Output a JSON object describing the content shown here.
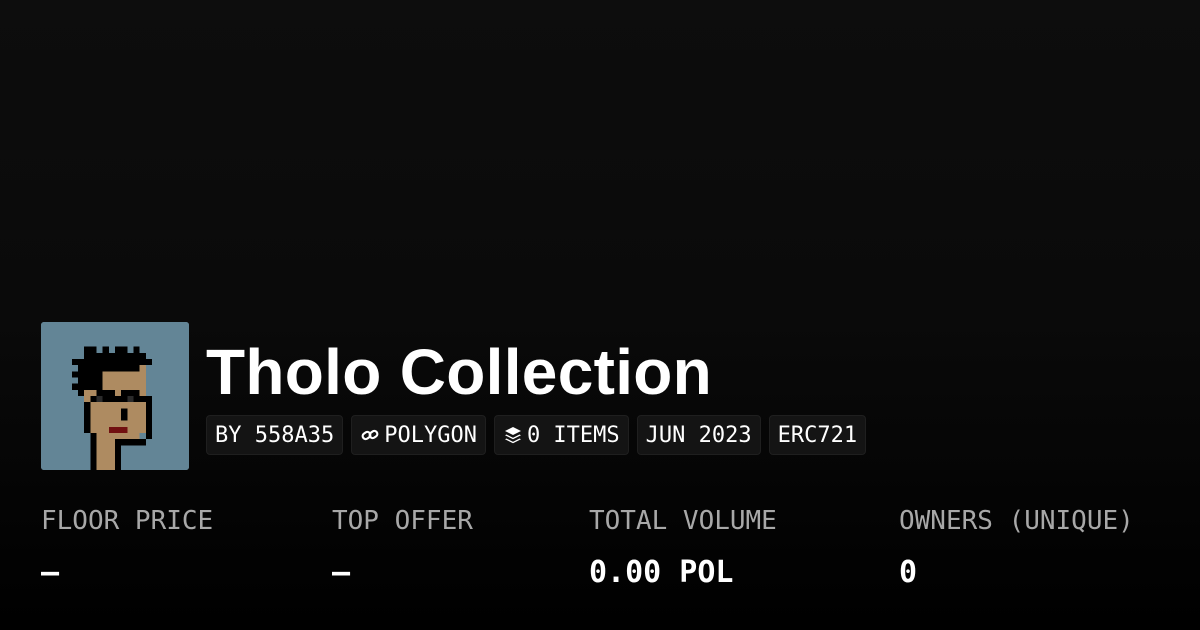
{
  "collection": {
    "title": "Tholo Collection",
    "avatar_alt": "pixel-art punk avatar with dark hair and sunglasses",
    "avatar_bg_color": "#638596"
  },
  "tags": [
    {
      "label": "BY 558A35",
      "icon": null
    },
    {
      "label": "POLYGON",
      "icon": "link-icon"
    },
    {
      "label": "0 ITEMS",
      "icon": "layers-icon"
    },
    {
      "label": "JUN 2023",
      "icon": null
    },
    {
      "label": "ERC721",
      "icon": null
    }
  ],
  "stats": {
    "floor_price": {
      "label": "FLOOR PRICE",
      "value": "–"
    },
    "top_offer": {
      "label": "TOP OFFER",
      "value": "–"
    },
    "total_volume": {
      "label": "TOTAL VOLUME",
      "value": "0.00 POL"
    },
    "owners": {
      "label": "OWNERS (UNIQUE)",
      "value": "0"
    }
  },
  "colors": {
    "background": "#0a0a0a",
    "tag_background": "#141414",
    "label_gray": "#a8a8a8",
    "text": "#ffffff"
  }
}
